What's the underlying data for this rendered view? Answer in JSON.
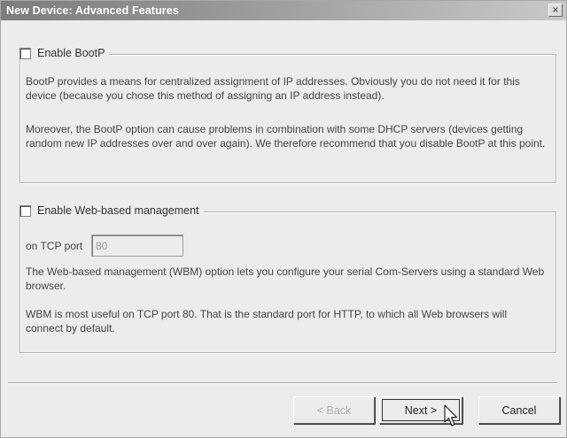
{
  "window": {
    "title": "New Device: Advanced Features",
    "close_glyph": "×"
  },
  "bootp": {
    "checkbox_label": "Enable BootP",
    "checked": false,
    "para1": "BootP provides a means for centralized assignment of IP addresses. Obviously you do not need it for this device (because you chose this method of assigning an IP address instead).",
    "para2": "Moreover, the BootP option can cause problems in combination with some DHCP servers (devices getting random new IP addresses over and over again). We therefore recommend that you disable BootP at this point."
  },
  "wbm": {
    "checkbox_label": "Enable Web-based management",
    "checked": false,
    "port_label": "on TCP port",
    "port_value": "80",
    "para1": "The Web-based management (WBM) option lets you configure your serial Com-Servers using a standard Web browser.",
    "para2": "WBM is most useful on TCP port 80. That is the standard port for HTTP, to which all Web browsers will connect by default."
  },
  "buttons": {
    "back": "< Back",
    "next": "Next >",
    "cancel": "Cancel"
  },
  "cursor_icon": "arrow-pointer-icon"
}
